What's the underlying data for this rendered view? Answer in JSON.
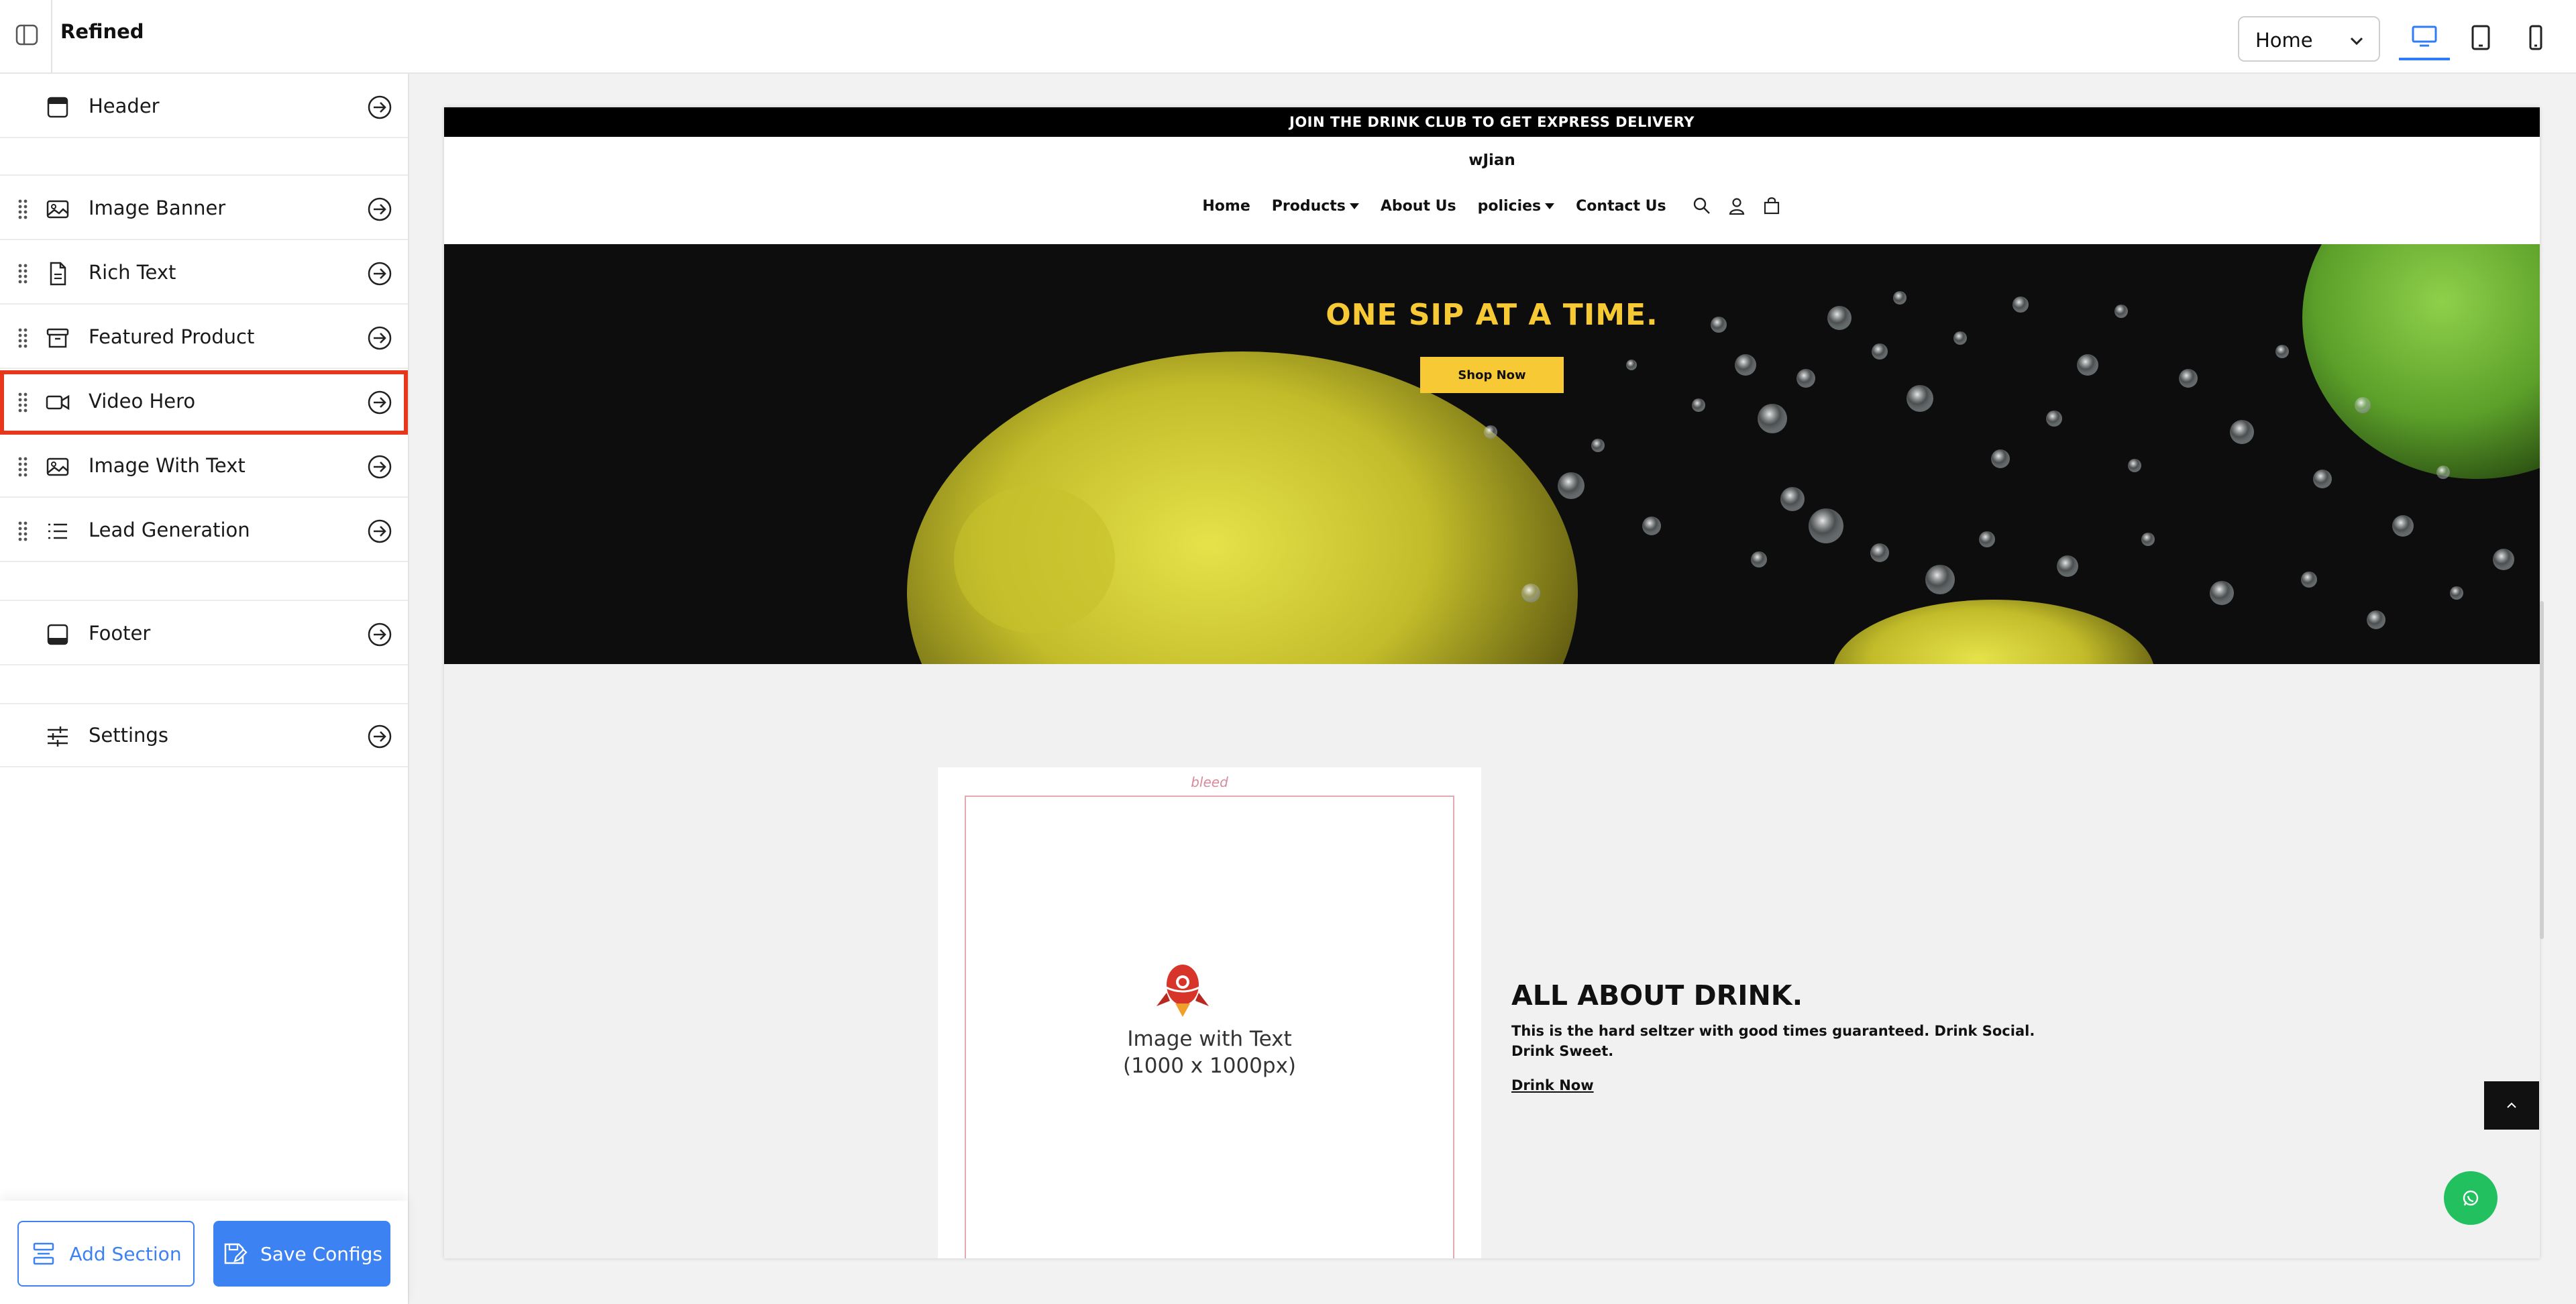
{
  "app": {
    "title": "Refined"
  },
  "toolbar": {
    "page_select_value": "Home",
    "devices": [
      "desktop",
      "tablet",
      "mobile"
    ]
  },
  "sidebar": {
    "header_label": "Header",
    "sections": [
      {
        "label": "Image Banner",
        "icon": "image-icon"
      },
      {
        "label": "Rich Text",
        "icon": "document-icon"
      },
      {
        "label": "Featured Product",
        "icon": "archive-box-icon"
      },
      {
        "label": "Video Hero",
        "icon": "video-camera-icon",
        "selected": true
      },
      {
        "label": "Image With Text",
        "icon": "image-icon"
      },
      {
        "label": "Lead Generation",
        "icon": "list-icon"
      }
    ],
    "footer_label": "Footer",
    "settings_label": "Settings",
    "add_section_label": "Add Section",
    "save_configs_label": "Save Configs"
  },
  "preview": {
    "announcement": "JOIN THE DRINK CLUB TO GET EXPRESS DELIVERY",
    "brand": "wJian",
    "nav": {
      "home": "Home",
      "products": "Products",
      "about": "About Us",
      "policies": "policies",
      "contact": "Contact Us"
    },
    "hero": {
      "title": "ONE SIP AT A TIME.",
      "button": "Shop Now"
    },
    "image_with_text": {
      "bleed_label": "bleed",
      "placeholder_line1": "Image with Text",
      "placeholder_line2": "(1000 x 1000px)",
      "title": "ALL ABOUT DRINK.",
      "body": "This is the hard seltzer with good times guaranteed. Drink Social. Drink Sweet.",
      "link": "Drink Now"
    }
  },
  "colors": {
    "accent": "#3d82f2",
    "selection_outline": "#e8361c",
    "hero_yellow": "#f6c935",
    "whatsapp_green": "#22c05e"
  }
}
